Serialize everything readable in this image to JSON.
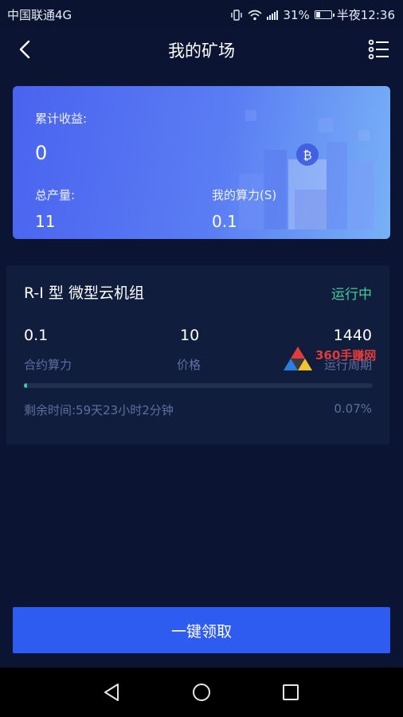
{
  "status_bar": {
    "carrier": "中国联通4G",
    "battery": "31%",
    "time": "半夜12:36",
    "battery_level": 0.31
  },
  "header": {
    "title": "我的矿场"
  },
  "summary": {
    "total_income_label": "累计收益:",
    "total_income_value": "0",
    "total_output_label": "总产量:",
    "total_output_value": "11",
    "my_hashrate_label": "我的算力(S)",
    "my_hashrate_value": "0.1"
  },
  "miner": {
    "name": "R-I 型 微型云机组",
    "status": "运行中",
    "stats": [
      {
        "value": "0.1",
        "label": "合约算力"
      },
      {
        "value": "10",
        "label": "价格"
      },
      {
        "value": "1440",
        "label": "运行周期"
      }
    ],
    "remaining": "剩余时间:59天23小时2分钟",
    "progress_text": "0.07%",
    "progress": 0.0007
  },
  "watermark": {
    "text": "360手赚网"
  },
  "actions": {
    "claim_label": "一键领取"
  },
  "colors": {
    "background": "#0b1533",
    "card": "#111d3d",
    "accent_green": "#3fcf9a",
    "button_blue": "#2f5cf0"
  },
  "icons": [
    "back-arrow-icon",
    "list-menu-icon",
    "vibrate-icon",
    "wifi-icon",
    "signal-icon",
    "battery-icon",
    "nav-back-icon",
    "nav-home-icon",
    "nav-recents-icon"
  ]
}
